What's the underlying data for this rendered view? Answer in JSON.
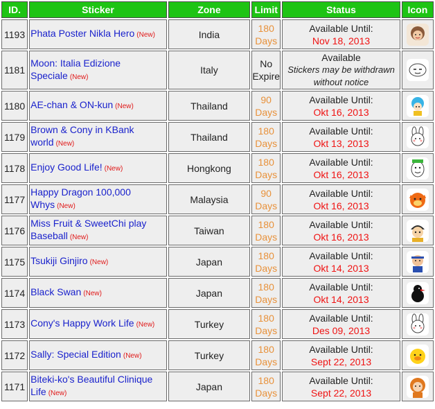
{
  "headers": {
    "id": "ID.",
    "sticker": "Sticker",
    "zone": "Zone",
    "limit": "Limit",
    "status": "Status",
    "icon": "Icon"
  },
  "new_badge": "(New)",
  "rows": [
    {
      "id": "1193",
      "name": "Phata Poster Nikla Hero",
      "zone": "India",
      "limit_line1": "180",
      "limit_line2": "Days",
      "status_line1": "Available Until:",
      "status_line2": "Nov 18, 2013",
      "icon": "girl-face-icon"
    },
    {
      "id": "1181",
      "name": "Moon: Italia Edizione Speciale",
      "zone": "Italy",
      "limit_line1": "No",
      "limit_line2": "Expire",
      "status_line1": "Available",
      "status_line2": "Stickers may be withdrawn without notice",
      "icon": "moon-face-icon"
    },
    {
      "id": "1180",
      "name": "AE-chan & ON-kun",
      "zone": "Thailand",
      "limit_line1": "90",
      "limit_line2": "Days",
      "status_line1": "Available Until:",
      "status_line2": "Okt 16, 2013",
      "icon": "blue-hair-girl-icon"
    },
    {
      "id": "1179",
      "name": "Brown & Cony in KBank world",
      "zone": "Thailand",
      "limit_line1": "180",
      "limit_line2": "Days",
      "status_line1": "Available Until:",
      "status_line2": "Okt 13, 2013",
      "icon": "cony-bunny-icon"
    },
    {
      "id": "1178",
      "name": "Enjoy Good Life!",
      "zone": "Hongkong",
      "limit_line1": "180",
      "limit_line2": "Days",
      "status_line1": "Available Until:",
      "status_line2": "Okt 16, 2013",
      "icon": "egg-character-icon"
    },
    {
      "id": "1177",
      "name": "Happy Dragon 100,000 Whys",
      "zone": "Malaysia",
      "limit_line1": "90",
      "limit_line2": "Days",
      "status_line1": "Available Until:",
      "status_line2": "Okt 16, 2013",
      "icon": "dragon-icon"
    },
    {
      "id": "1176",
      "name": "Miss Fruit & SweetChi play Baseball",
      "zone": "Taiwan",
      "limit_line1": "180",
      "limit_line2": "Days",
      "status_line1": "Available Until:",
      "status_line2": "Okt 16, 2013",
      "icon": "baseball-player-icon"
    },
    {
      "id": "1175",
      "name": "Tsukiji Ginjiro",
      "zone": "Japan",
      "limit_line1": "180",
      "limit_line2": "Days",
      "status_line1": "Available Until:",
      "status_line2": "Okt 14, 2013",
      "icon": "man-headband-icon"
    },
    {
      "id": "1174",
      "name": "Black Swan",
      "zone": "Japan",
      "limit_line1": "180",
      "limit_line2": "Days",
      "status_line1": "Available Until:",
      "status_line2": "Okt 14, 2013",
      "icon": "black-swan-icon"
    },
    {
      "id": "1173",
      "name": "Cony's Happy Work Life",
      "zone": "Turkey",
      "limit_line1": "180",
      "limit_line2": "Days",
      "status_line1": "Available Until:",
      "status_line2": "Des 09, 2013",
      "icon": "cony-bunny-icon"
    },
    {
      "id": "1172",
      "name": "Sally: Special Edition",
      "zone": "Turkey",
      "limit_line1": "180",
      "limit_line2": "Days",
      "status_line1": "Available Until:",
      "status_line2": "Sept 22, 2013",
      "icon": "sally-duck-icon"
    },
    {
      "id": "1171",
      "name": "Biteki-ko's Beautiful Clinique Life",
      "zone": "Japan",
      "limit_line1": "180",
      "limit_line2": "Days",
      "status_line1": "Available Until:",
      "status_line2": "Sept 22, 2013",
      "icon": "orange-hair-woman-icon"
    }
  ],
  "colors": {
    "header_bg": "#1ec414",
    "link": "#1a22cc",
    "new_badge": "#e01818",
    "limit": "#e8913a",
    "date": "#f01212",
    "cell_bg": "#eeeeee"
  }
}
